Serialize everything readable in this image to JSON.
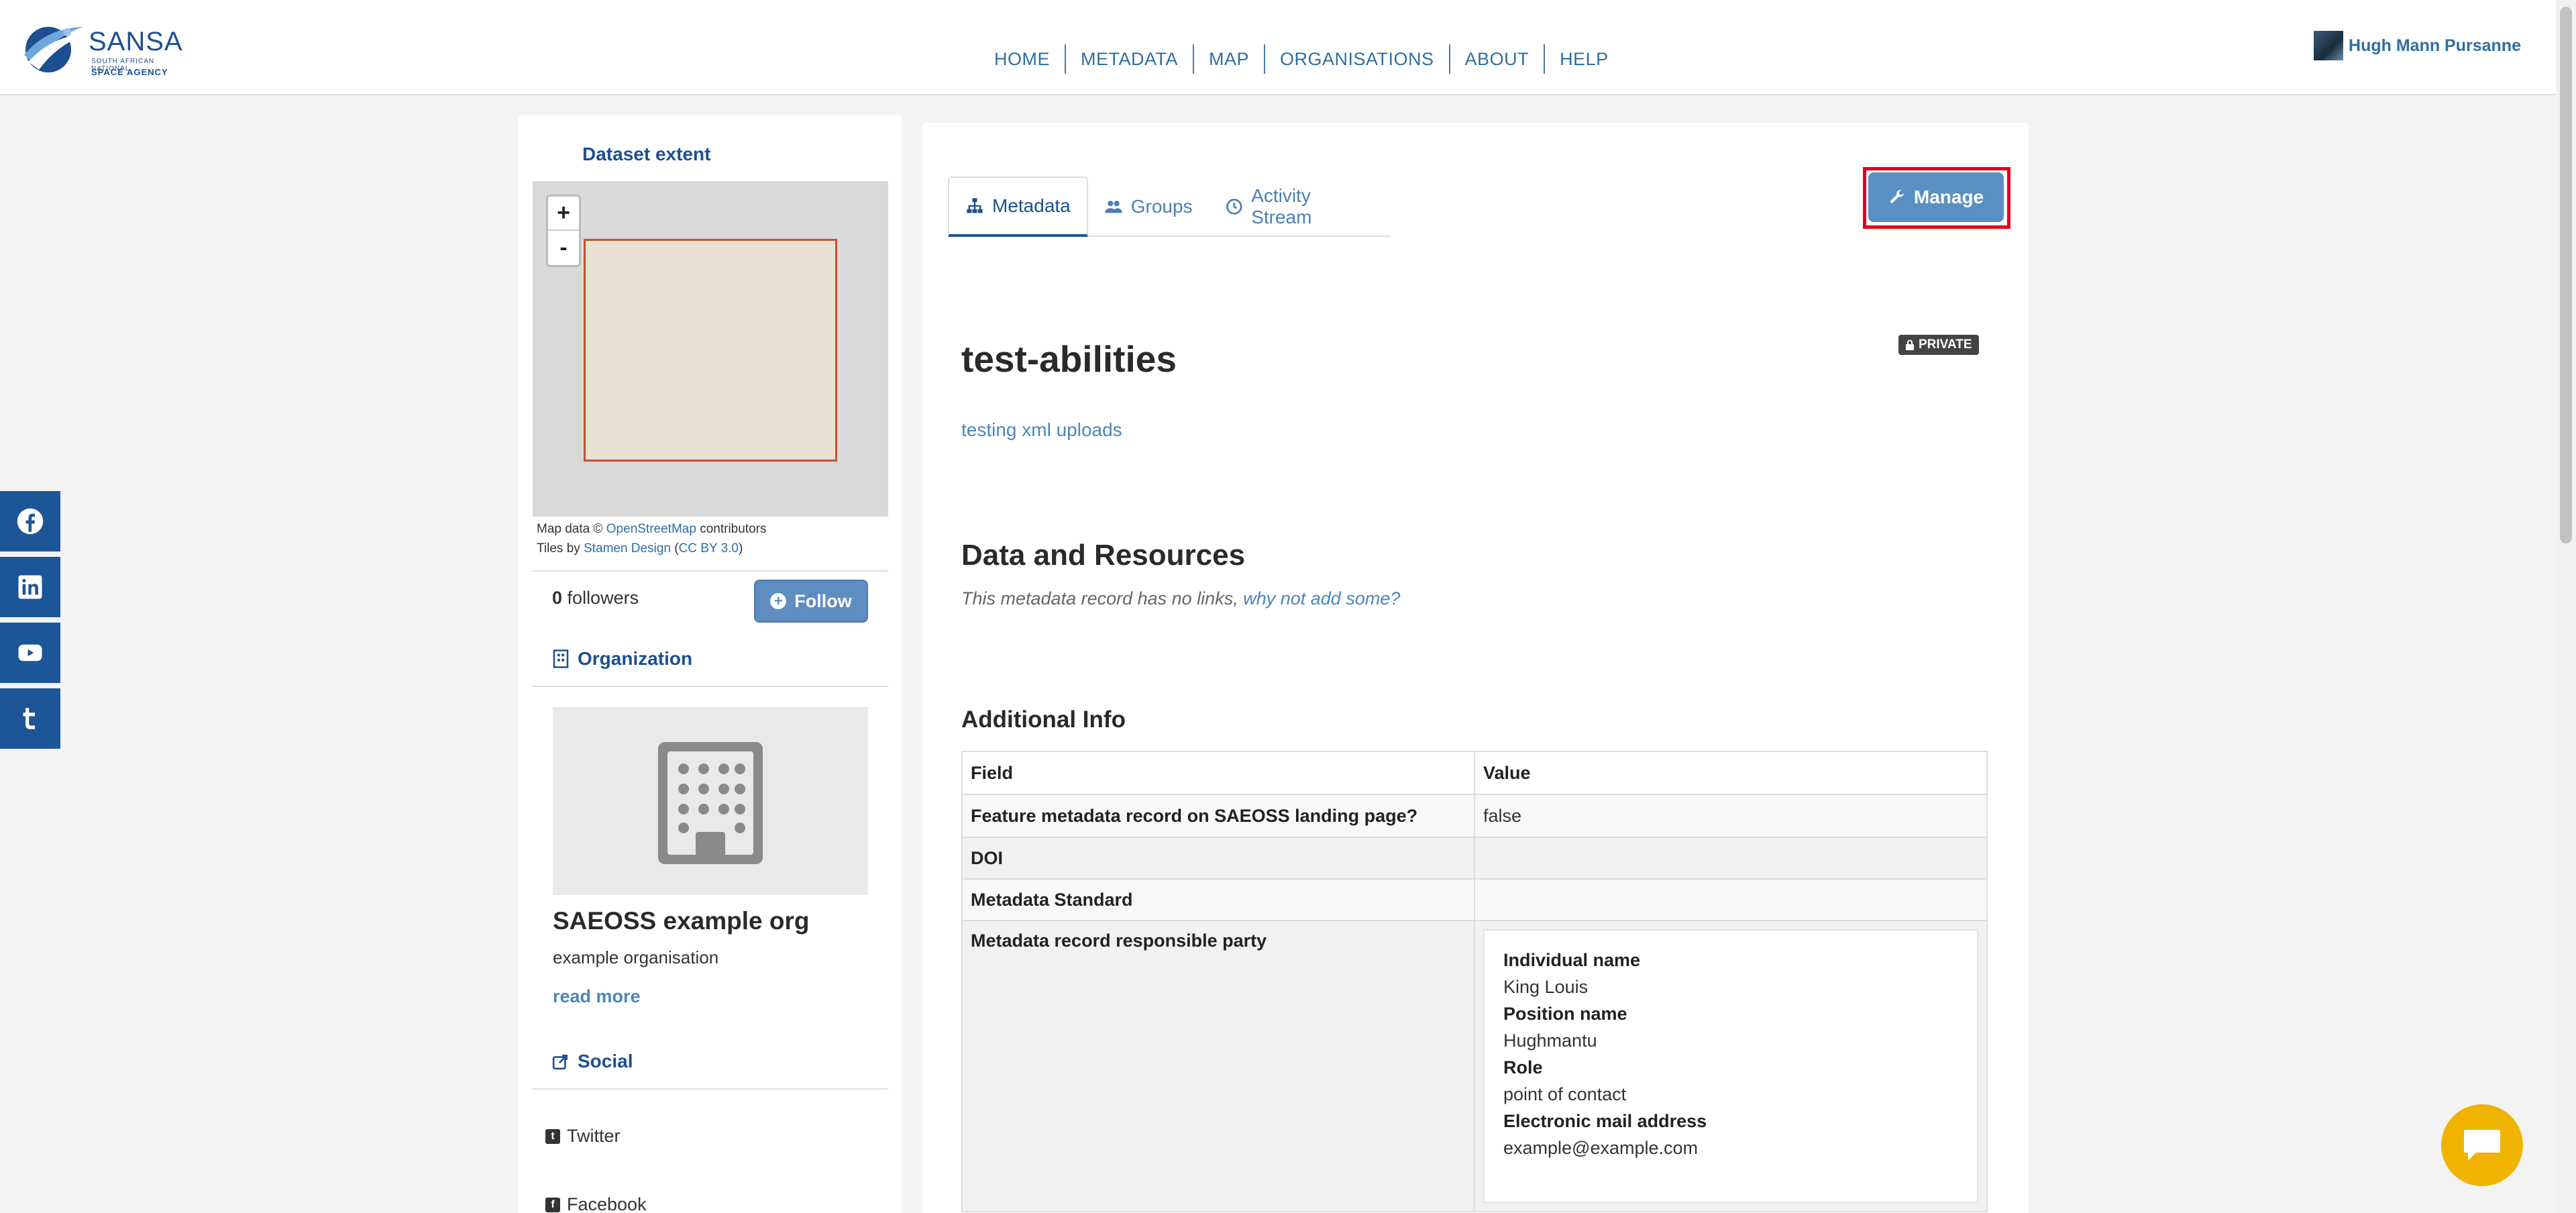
{
  "header": {
    "logo": {
      "name": "SANSA",
      "tagline_small": "SOUTH AFRICAN NATIONAL",
      "tagline": "SPACE AGENCY"
    },
    "nav": [
      "HOME",
      "METADATA",
      "MAP",
      "ORGANISATIONS",
      "ABOUT",
      "HELP"
    ],
    "user_name": "Hugh Mann Pursanne"
  },
  "sidebar": {
    "dataset_extent_title": "Dataset extent",
    "map": {
      "zoom_in": "+",
      "zoom_out": "-",
      "attribution_prefix": "Map data ©",
      "attribution_osm": "OpenStreetMap",
      "attribution_contrib": "contributors",
      "tiles_prefix": "Tiles by",
      "tiles_stamen": "Stamen Design",
      "tiles_license": "CC BY 3.0"
    },
    "followers_count": "0",
    "followers_label": "followers",
    "follow_label": "Follow",
    "organization_title": "Organization",
    "org_name": "SAEOSS example org",
    "org_description": "example organisation",
    "read_more": "read more",
    "social_title": "Social",
    "social_links": [
      "Twitter",
      "Facebook"
    ]
  },
  "main": {
    "tabs": [
      "Metadata",
      "Groups",
      "Activity Stream"
    ],
    "manage_label": "Manage",
    "title": "test-abilities",
    "private_badge": "PRIVATE",
    "notes": "testing xml uploads",
    "resources_title": "Data and Resources",
    "no_links_text": "This metadata record has no links,",
    "no_links_link": "why not add some?",
    "additional_info_title": "Additional Info",
    "table": {
      "headers": [
        "Field",
        "Value"
      ],
      "rows": [
        {
          "field": "Feature metadata record on SAEOSS landing page?",
          "value": "false"
        },
        {
          "field": "DOI",
          "value": ""
        },
        {
          "field": "Metadata Standard",
          "value": ""
        },
        {
          "field": "Metadata record responsible party",
          "value": ""
        }
      ],
      "party": {
        "individual_name_label": "Individual name",
        "individual_name": "King Louis",
        "position_name_label": "Position name",
        "position_name": "Hughmantu",
        "role_label": "Role",
        "role": "point of contact",
        "email_label": "Electronic mail address",
        "email": "example@example.com"
      }
    }
  },
  "colors": {
    "brand_blue": "#1d4f91",
    "link_blue": "#2f6ea3",
    "manage_highlight": "#e0001b",
    "chat_yellow": "#f0b400"
  }
}
